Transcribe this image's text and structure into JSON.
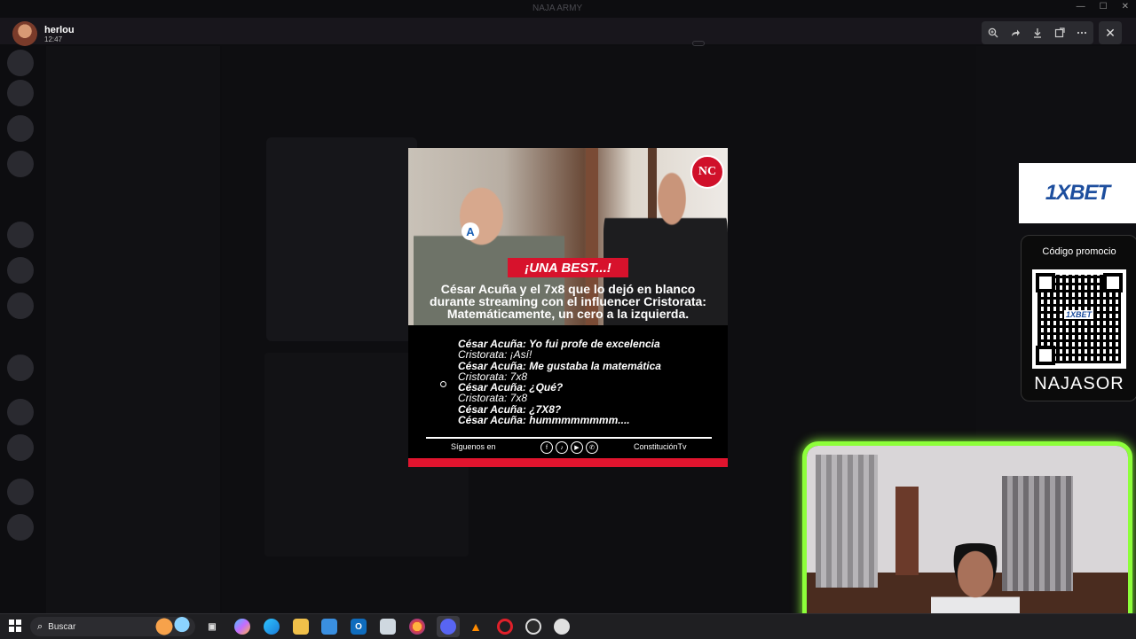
{
  "window": {
    "server_title": "NAJA ARMY",
    "controls": [
      "—",
      "☐",
      "✕"
    ]
  },
  "viewer": {
    "user_name": "herlou",
    "time": "12:47",
    "tools": [
      "zoom-in",
      "forward",
      "download",
      "open-external",
      "more"
    ],
    "close": "✕"
  },
  "post": {
    "tag": "¡UNA BEST...!",
    "logo": "NC",
    "party_logo": "A",
    "headline": "César Acuña y el 7x8 que lo dejó en blanco durante streaming con el influencer Cristorata: Matemáticamente, un cero a la izquierda.",
    "dialogue": [
      {
        "text": "César Acuña: Yo fui profe de excelencia",
        "bold": true
      },
      {
        "text": "Cristorata: ¡Así!",
        "bold": false
      },
      {
        "text": "César Acuña: Me gustaba la matemática",
        "bold": true
      },
      {
        "text": "Cristorata: 7x8",
        "bold": false
      },
      {
        "text": "César Acuña: ¿Qué?",
        "bold": true
      },
      {
        "text": "Cristorata: 7x8",
        "bold": false
      },
      {
        "text": "César Acuña: ¿7X8?",
        "bold": true
      },
      {
        "text": "César Acuña: hummmmmmmm....",
        "bold": true
      }
    ],
    "follow_label": "Síguenos en",
    "social_icons": [
      "facebook-icon",
      "tiktok-icon",
      "youtube-icon",
      "whatsapp-icon"
    ],
    "brand": "ConstituciónTv"
  },
  "ads": {
    "bet_logo": "1XBET",
    "promo_label": "Código promocio",
    "qr_logo": "1XBET",
    "promo_code": "NAJASOR"
  },
  "taskbar": {
    "search_placeholder": "Buscar",
    "apps": [
      "task-view",
      "copilot",
      "edge",
      "file-explorer",
      "store",
      "outlook",
      "media",
      "firefox",
      "discord",
      "vlc",
      "opera",
      "obs",
      "app"
    ]
  },
  "colors": {
    "accent_green": "#8dff3a",
    "brand_red": "#d7122c",
    "bet_blue": "#1d4e9e"
  }
}
